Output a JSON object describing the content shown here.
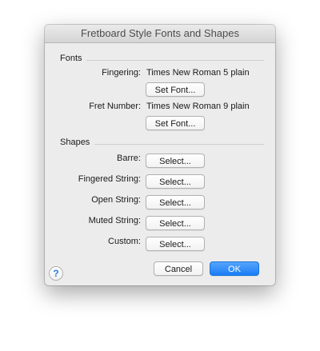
{
  "window": {
    "title": "Fretboard Style Fonts and Shapes"
  },
  "fonts": {
    "section_label": "Fonts",
    "fingering": {
      "label": "Fingering:",
      "value": "Times New Roman 5 plain",
      "button": "Set Font..."
    },
    "fret_number": {
      "label": "Fret Number:",
      "value": "Times New Roman 9 plain",
      "button": "Set Font..."
    }
  },
  "shapes": {
    "section_label": "Shapes",
    "rows": [
      {
        "label": "Barre:",
        "button": "Select..."
      },
      {
        "label": "Fingered String:",
        "button": "Select..."
      },
      {
        "label": "Open String:",
        "button": "Select..."
      },
      {
        "label": "Muted String:",
        "button": "Select..."
      },
      {
        "label": "Custom:",
        "button": "Select..."
      }
    ]
  },
  "footer": {
    "help_glyph": "?",
    "help_icon": "question-mark-icon",
    "cancel_label": "Cancel",
    "ok_label": "OK"
  },
  "colors": {
    "accent": "#1a7ff6",
    "dialog_bg": "#ececec"
  }
}
